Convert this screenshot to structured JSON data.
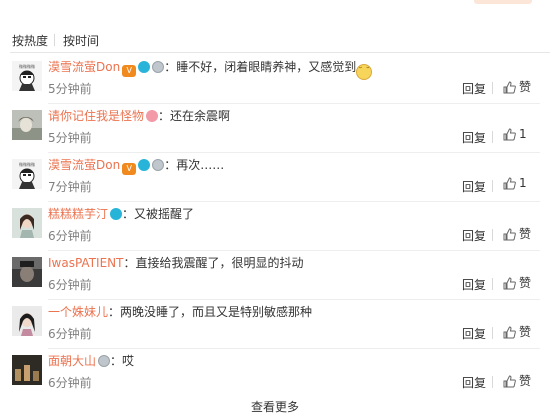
{
  "sort": {
    "hot": "按热度",
    "time": "按时间"
  },
  "comments": [
    {
      "user": "漠雪流萤Don",
      "text": "：睡不好，闭着眼睛养神，又感觉到",
      "time": "5分钟前",
      "reply": "回复",
      "like": "赞",
      "badges": [
        "vip",
        "eye",
        "medal"
      ],
      "emoji": true
    },
    {
      "user": "请你记住我是怪物",
      "text": "：还在余震啊",
      "time": "5分钟前",
      "reply": "回复",
      "like": "1",
      "badges": [
        "pink"
      ],
      "emoji": false
    },
    {
      "user": "漠雪流萤Don",
      "text": "：再次……",
      "time": "7分钟前",
      "reply": "回复",
      "like": "1",
      "badges": [
        "vip",
        "eye",
        "medal"
      ],
      "emoji": false
    },
    {
      "user": "糕糕糕芋汀",
      "text": "：又被摇醒了",
      "time": "6分钟前",
      "reply": "回复",
      "like": "赞",
      "badges": [
        "eye"
      ],
      "emoji": false
    },
    {
      "user": "IwasPATIENT",
      "text": "：直接给我震醒了，很明显的抖动",
      "time": "6分钟前",
      "reply": "回复",
      "like": "赞",
      "badges": [],
      "emoji": false
    },
    {
      "user": "一个姝妹儿",
      "text": "：两晚没睡了，而且又是特别敏感那种",
      "time": "6分钟前",
      "reply": "回复",
      "like": "赞",
      "badges": [],
      "emoji": false
    },
    {
      "user": "面朝大山",
      "text": "：哎",
      "time": "6分钟前",
      "reply": "回复",
      "like": "赞",
      "badges": [
        "medal"
      ],
      "emoji": false
    }
  ],
  "more": "查看更多"
}
